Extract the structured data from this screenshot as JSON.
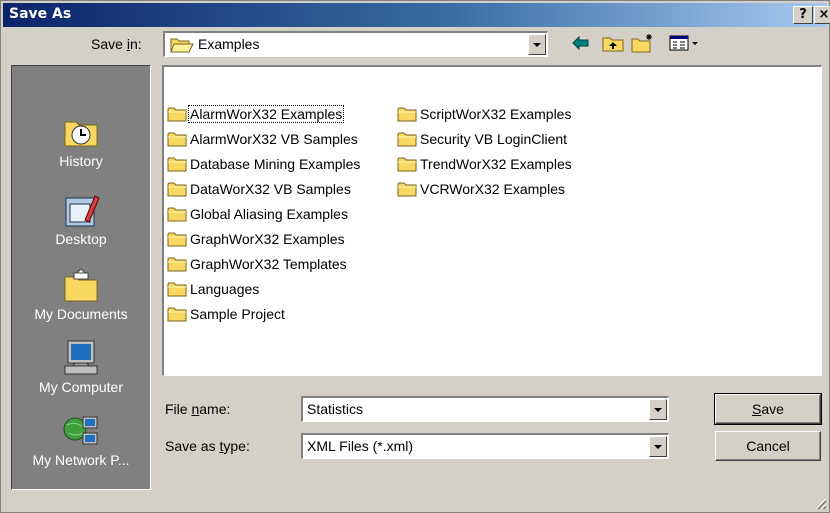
{
  "window": {
    "title": "Save As",
    "help_button": "?",
    "close_button": "×"
  },
  "save_in": {
    "label_pre": "Save ",
    "label_accel": "i",
    "label_post": "n:",
    "value": "Examples"
  },
  "places": [
    {
      "label": "History",
      "icon": "history-icon"
    },
    {
      "label": "Desktop",
      "icon": "desktop-icon"
    },
    {
      "label": "My Documents",
      "icon": "my-documents-icon"
    },
    {
      "label": "My Computer",
      "icon": "my-computer-icon"
    },
    {
      "label": "My Network P...",
      "icon": "my-network-places-icon"
    }
  ],
  "files": {
    "column1": [
      "AlarmWorX32 Examples",
      "AlarmWorX32 VB Samples",
      "Database Mining Examples",
      "DataWorX32 VB Samples",
      "Global Aliasing Examples",
      "GraphWorX32 Examples",
      "GraphWorX32 Templates",
      "Languages",
      "Sample Project"
    ],
    "column2": [
      "ScriptWorX32 Examples",
      "Security VB LoginClient",
      "TrendWorX32 Examples",
      "VCRWorX32 Examples"
    ]
  },
  "file_name": {
    "label_pre": "File ",
    "label_accel": "n",
    "label_post": "ame:",
    "value": "Statistics"
  },
  "save_as_type": {
    "label_pre": "Save as ",
    "label_accel": "t",
    "label_post": "ype:",
    "value": "XML Files (*.xml)"
  },
  "buttons": {
    "save_accel": "S",
    "save_rest": "ave",
    "cancel": "Cancel"
  },
  "colors": {
    "title_gradient_start": "#0a246a",
    "title_gradient_end": "#a6caf0",
    "dialog_face": "#d4d0c8",
    "places_bar": "#808080",
    "folder_yellow": "#f8d860"
  }
}
